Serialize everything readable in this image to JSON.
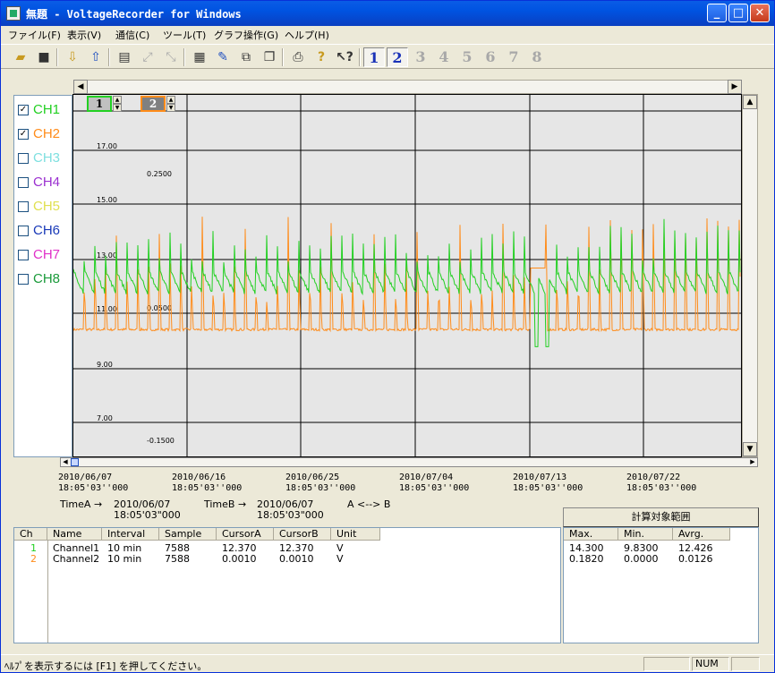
{
  "window": {
    "title": "無題 - VoltageRecorder for Windows",
    "controls": {
      "minimize": "_",
      "maximize": "□",
      "close": "✕"
    }
  },
  "menu": [
    "ファイル(F)",
    "表示(V)",
    "通信(C)",
    "ツール(T)",
    "グラフ操作(G)",
    "ヘルプ(H)"
  ],
  "toolbar": {
    "icons": [
      "open-icon",
      "save-icon",
      "download-icon",
      "upload-icon",
      "document-icon",
      "zoom-in-icon",
      "zoom-out-icon",
      "grid-icon",
      "pen-icon",
      "copy-icon",
      "window-icon",
      "print-icon",
      "help-icon",
      "context-help-icon"
    ],
    "pages": [
      "1",
      "2",
      "3",
      "4",
      "5",
      "6",
      "7",
      "8"
    ],
    "active_pages": [
      "1",
      "2"
    ]
  },
  "channels": [
    {
      "label": "CH1",
      "checked": true,
      "color": "#22d022"
    },
    {
      "label": "CH2",
      "checked": true,
      "color": "#ff8c1a"
    },
    {
      "label": "CH3",
      "checked": false,
      "color": "#7fe0e0"
    },
    {
      "label": "CH4",
      "checked": false,
      "color": "#9b30d0"
    },
    {
      "label": "CH5",
      "checked": false,
      "color": "#e0e050"
    },
    {
      "label": "CH6",
      "checked": false,
      "color": "#1a3ab8"
    },
    {
      "label": "CH7",
      "checked": false,
      "color": "#e030c8"
    },
    {
      "label": "CH8",
      "checked": false,
      "color": "#1a9a3a"
    }
  ],
  "scale_selectors": [
    {
      "value": "1",
      "color": "#22d022"
    },
    {
      "value": "2",
      "color": "#ff8c1a"
    }
  ],
  "y_axis_ch1": [
    "17.00",
    "15.00",
    "13.00",
    "11.00",
    "9.00",
    "7.00"
  ],
  "y_axis_ch2": [
    "0.2500",
    "0.0500",
    "-0.1500"
  ],
  "x_axis": [
    {
      "date": "2010/06/07",
      "time": "18:05'03''000"
    },
    {
      "date": "2010/06/16",
      "time": "18:05'03''000"
    },
    {
      "date": "2010/06/25",
      "time": "18:05'03''000"
    },
    {
      "date": "2010/07/04",
      "time": "18:05'03''000"
    },
    {
      "date": "2010/07/13",
      "time": "18:05'03''000"
    },
    {
      "date": "2010/07/22",
      "time": "18:05'03''000"
    }
  ],
  "chart_data": {
    "type": "line",
    "series": [
      {
        "name": "CH1",
        "color": "#22d022",
        "scale": "Channel1",
        "y_range": [
          6.0,
          19.0
        ],
        "baseline": 12.4,
        "spike_max": 14.3,
        "min": 9.83
      },
      {
        "name": "CH2",
        "color": "#ff8c1a",
        "scale": "Channel2",
        "y_range": [
          -0.2,
          0.35
        ],
        "baseline": 0.0,
        "spike_max": 0.182,
        "min": 0.0
      }
    ],
    "x_range": [
      "2010/06/07",
      "2010/07/29"
    ],
    "grid": true
  },
  "time_cursors": {
    "timeA_label": "TimeA →",
    "timeA_date": "2010/06/07",
    "timeA_time": "18:05'03\"000",
    "timeB_label": "TimeB →",
    "timeB_date": "2010/06/07",
    "timeB_time": "18:05'03\"000",
    "ab_label": "A <--> B"
  },
  "calc_range_button": "計算対象範囲",
  "channel_table": {
    "headers": [
      "Ch",
      "Name",
      "Interval",
      "Sample",
      "CursorA",
      "CursorB",
      "Unit"
    ],
    "rows": [
      {
        "ch": "1",
        "name": "Channel1",
        "interval": "10 min",
        "sample": "7588",
        "cursorA": "12.370",
        "cursorB": "12.370",
        "unit": "V",
        "color": "#22d022"
      },
      {
        "ch": "2",
        "name": "Channel2",
        "interval": "10 min",
        "sample": "7588",
        "cursorA": "0.0010",
        "cursorB": "0.0010",
        "unit": "V",
        "color": "#ff8c1a"
      }
    ]
  },
  "stats_table": {
    "headers": [
      "Max.",
      "Min.",
      "Avrg."
    ],
    "rows": [
      {
        "max": "14.300",
        "min": "9.8300",
        "avg": "12.426"
      },
      {
        "max": "0.1820",
        "min": "0.0000",
        "avg": "0.0126"
      }
    ]
  },
  "status": {
    "help_text": "ﾍﾙﾌﾟを表示するには [F1] を押してください。",
    "num": "NUM"
  }
}
